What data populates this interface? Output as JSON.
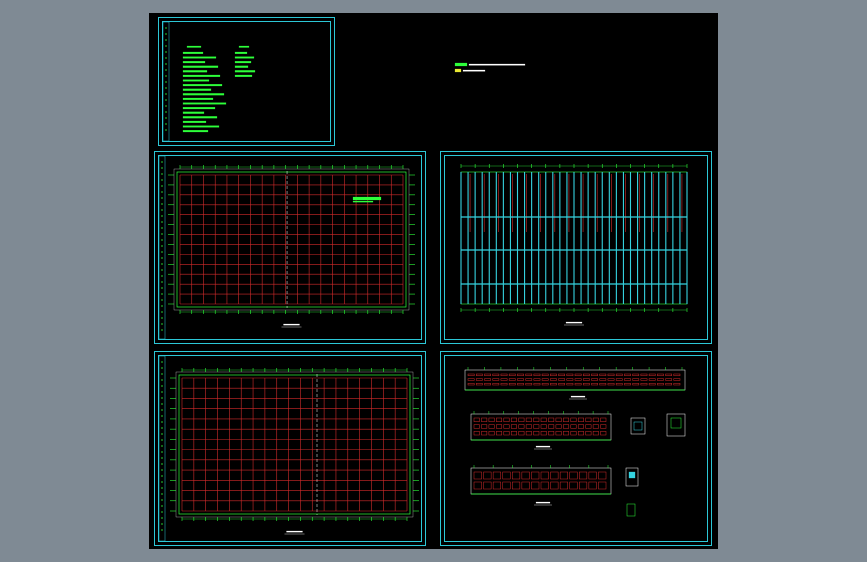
{
  "colors": {
    "app_background": "#7f8a94",
    "canvas_background": "#000000",
    "frame": "#2cc7d6",
    "grid_red": "#d22b2b",
    "grid_cyan": "#35d3e0",
    "annotation_green": "#2dff3a",
    "annotation_yellow": "#e8e832",
    "text_white": "#ffffff"
  },
  "icons": {
    "title_block": "vertical-title-strip",
    "drawing_label": "underlined-caption"
  },
  "sheets": [
    {
      "id": "notes",
      "kind": "design-notes"
    },
    {
      "id": "plan-1",
      "kind": "column-grid-plan"
    },
    {
      "id": "roof-plan",
      "kind": "purlin-layout-plan"
    },
    {
      "id": "plan-2",
      "kind": "column-grid-plan"
    },
    {
      "id": "elevations",
      "kind": "elevations-and-details"
    }
  ]
}
